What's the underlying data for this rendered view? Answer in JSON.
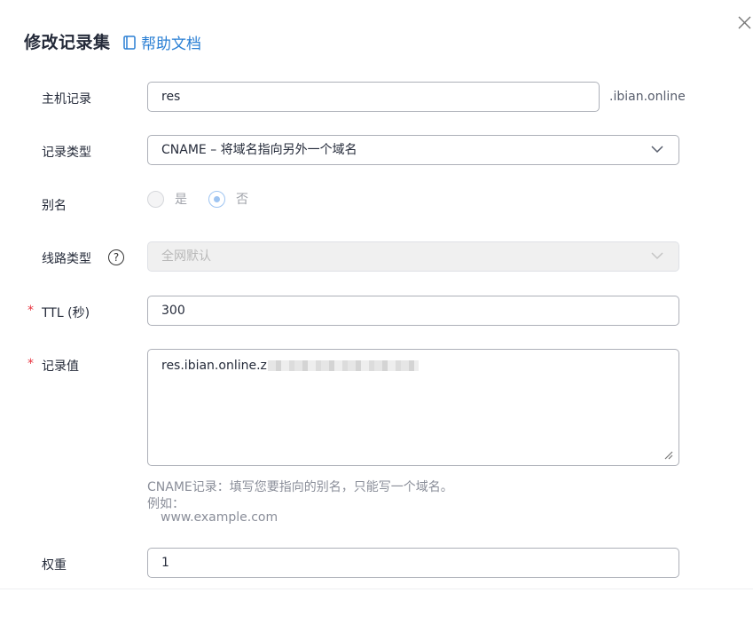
{
  "dialog": {
    "title": "修改记录集",
    "help_link": "帮助文档"
  },
  "fields": {
    "host": {
      "label": "主机记录",
      "value": "res",
      "suffix": ".ibian.online"
    },
    "type": {
      "label": "记录类型",
      "value": "CNAME – 将域名指向另外一个域名"
    },
    "alias": {
      "label": "别名",
      "options": [
        "是",
        "否"
      ],
      "selected": "否"
    },
    "line": {
      "label": "线路类型",
      "help": "?",
      "value": "全网默认"
    },
    "ttl": {
      "label": "TTL (秒)",
      "required_mark": "*",
      "value": "300"
    },
    "record_value": {
      "label": "记录值",
      "required_mark": "*",
      "value": "res.ibian.online.z"
    },
    "hint": {
      "line1": "CNAME记录：填写您要指向的别名，只能写一个域名。",
      "line2": "例如：",
      "line3": "www.example.com"
    },
    "weight": {
      "label": "权重",
      "value": "1"
    }
  },
  "colors": {
    "accent": "#2a7fd4",
    "required": "#e7333f",
    "border": "#adb0b8"
  }
}
